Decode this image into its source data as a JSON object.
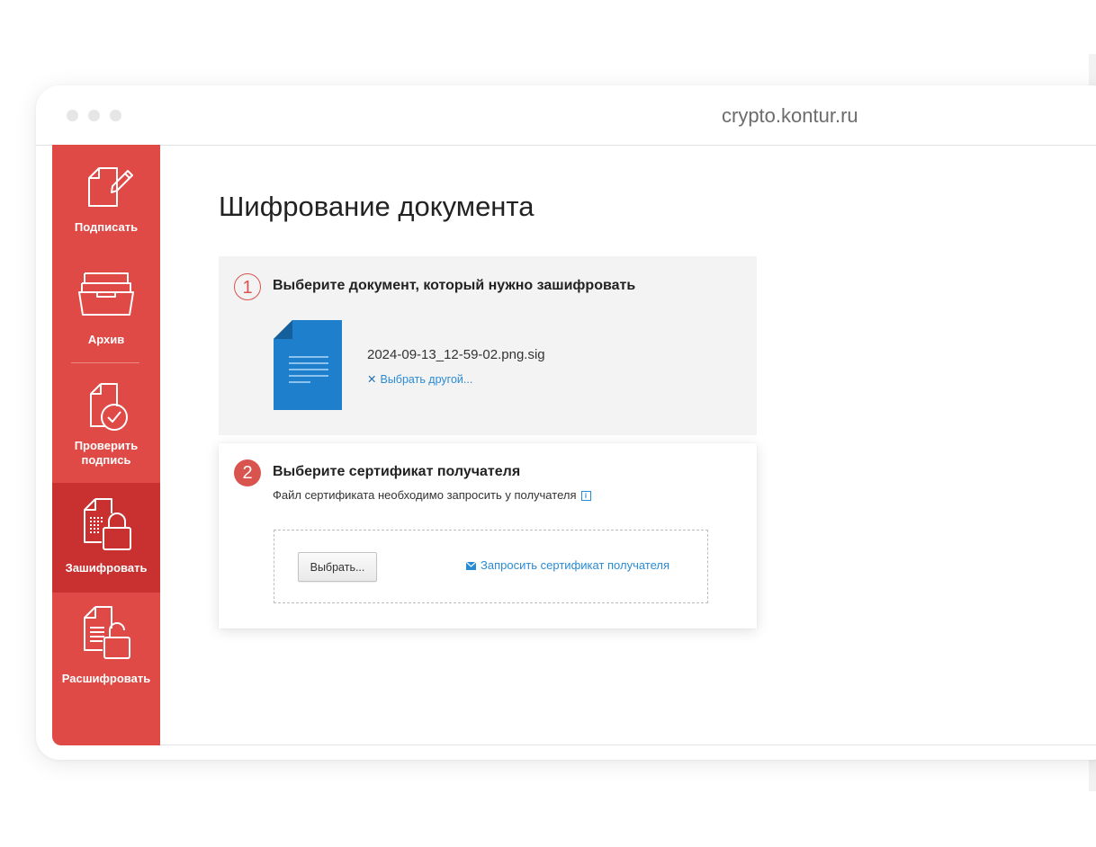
{
  "browser": {
    "url": "crypto.kontur.ru"
  },
  "sidebar": {
    "items": [
      {
        "label": "Подписать",
        "icon": "sign-icon",
        "active": false
      },
      {
        "label": "Архив",
        "icon": "archive-icon",
        "active": false
      },
      {
        "label": "Проверить подпись",
        "icon": "verify-signature-icon",
        "active": false
      },
      {
        "label": "Зашифровать",
        "icon": "encrypt-icon",
        "active": true
      },
      {
        "label": "Расшифровать",
        "icon": "decrypt-icon",
        "active": false
      }
    ]
  },
  "page": {
    "title": "Шифрование документа"
  },
  "step1": {
    "number": "1",
    "heading": "Выберите документ, который нужно зашифровать",
    "file_name": "2024-09-13_12-59-02.png.sig",
    "choose_other_label": "Выбрать другой..."
  },
  "step2": {
    "number": "2",
    "heading": "Выберите сертификат получателя",
    "subtext": "Файл сертификата необходимо запросить у получателя",
    "choose_button_label": "Выбрать...",
    "request_link_label": "Запросить сертификат получателя"
  },
  "colors": {
    "sidebar": "#e04a46",
    "sidebar_active": "#c8312f",
    "accent": "#d9534f",
    "link": "#2a8bd5",
    "document_icon": "#1e7fcd"
  }
}
